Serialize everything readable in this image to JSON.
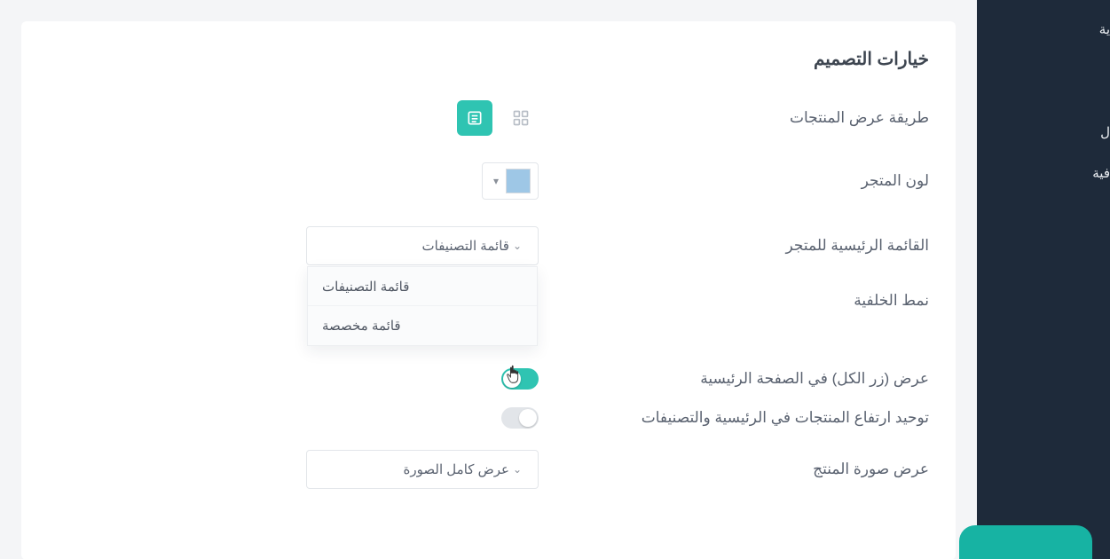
{
  "sidebar": {
    "items": [
      {
        "label": "ية"
      },
      {
        "label": "ل"
      },
      {
        "label": "فية"
      }
    ]
  },
  "section": {
    "title": "خيارات التصميم"
  },
  "rows": {
    "display_mode": {
      "label": "طريقة عرض المنتجات"
    },
    "store_color": {
      "label": "لون المتجر",
      "value": "#9ec7e6"
    },
    "main_menu": {
      "label": "القائمة الرئيسية للمتجر",
      "selected": "قائمة التصنيفات",
      "options": [
        "قائمة التصنيفات",
        "قائمة مخصصة"
      ]
    },
    "bg_pattern": {
      "label": "نمط الخلفية"
    },
    "show_all_button": {
      "label": "عرض (زر الكل) في الصفحة الرئيسية",
      "on": true
    },
    "unify_height": {
      "label": "توحيد ارتفاع المنتجات في الرئيسية والتصنيفات",
      "on": false
    },
    "product_image": {
      "label": "عرض صورة المنتج",
      "selected": "عرض كامل الصورة"
    }
  }
}
